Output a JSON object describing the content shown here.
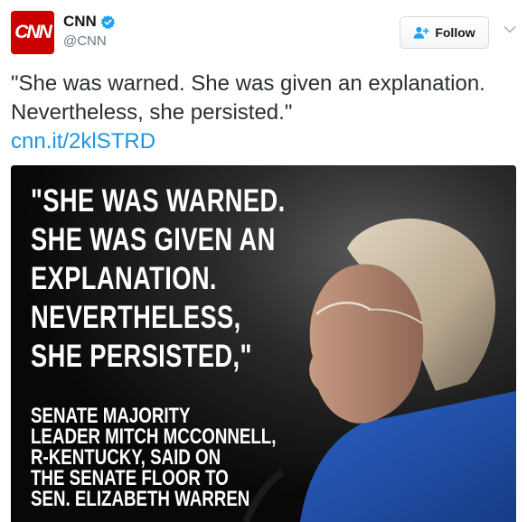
{
  "account": {
    "display_name": "CNN",
    "handle": "@CNN",
    "avatar_text": "CNN",
    "verified": true
  },
  "actions": {
    "follow_label": "Follow"
  },
  "tweet": {
    "text": "\"She was warned. She was given an explanation. Nevertheless, she persisted.\"",
    "link": "cnn.it/2klSTRD"
  },
  "media": {
    "quote_lines": [
      "\"SHE WAS WARNED.",
      "SHE WAS GIVEN AN",
      "EXPLANATION.",
      "NEVERTHELESS,",
      "SHE PERSISTED,\""
    ],
    "attribution": "SENATE MAJORITY\nLEADER MITCH MCCONNELL,\nR-KENTUCKY, SAID ON\nTHE SENATE FLOOR TO\nSEN. ELIZABETH WARREN"
  },
  "colors": {
    "brand": "#cc0000",
    "link": "#1b95e0",
    "verified": "#1da1f2",
    "sweater": "#1f4fa8"
  },
  "icons": {
    "verified": "verified-badge-icon",
    "follow": "person-plus-icon",
    "menu": "chevron-down-icon"
  }
}
